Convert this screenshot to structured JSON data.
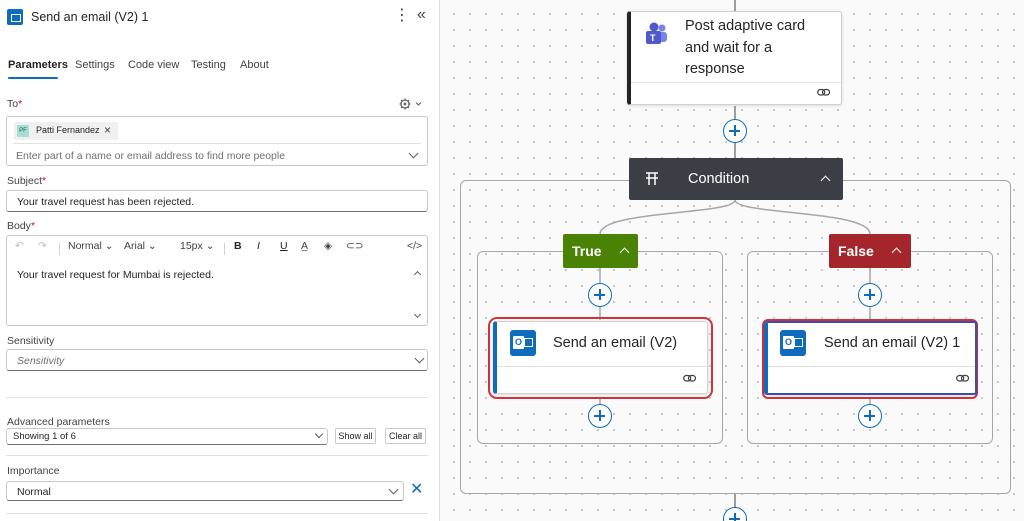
{
  "panel": {
    "title": "Send an email (V2) 1",
    "more_glyph": "⋮",
    "collapse_glyph": "«",
    "tabs": [
      {
        "label": "Parameters",
        "active": true
      },
      {
        "label": "Settings",
        "active": false
      },
      {
        "label": "Code view",
        "active": false
      },
      {
        "label": "Testing",
        "active": false
      },
      {
        "label": "About",
        "active": false
      }
    ],
    "to": {
      "label": "To",
      "recipient_initials": "PF",
      "recipient_name": "Patti Fernandez",
      "placeholder": "Enter part of a name or email address to find more people"
    },
    "subject": {
      "label": "Subject",
      "value": "Your travel request has been rejected."
    },
    "body": {
      "label": "Body",
      "value": "Your travel request for Mumbai is rejected.",
      "toolbar": {
        "font": "Normal",
        "family": "Arial",
        "size": "15px",
        "bold": "B",
        "italic": "I",
        "underline": "U",
        "code": "</>"
      }
    },
    "sensitivity": {
      "label": "Sensitivity",
      "placeholder": "Sensitivity"
    },
    "advanced": {
      "label": "Advanced parameters",
      "value": "Showing 1 of 6",
      "show_all": "Show all",
      "clear_all": "Clear all"
    },
    "importance": {
      "label": "Importance",
      "value": "Normal"
    },
    "required_mark": "*"
  },
  "canvas": {
    "post_card": {
      "title_line1": "Post adaptive card",
      "title_line2": "and wait for a",
      "title_line3": "response"
    },
    "condition": {
      "label": "Condition"
    },
    "true_branch": {
      "label": "True",
      "color": "#498205",
      "action": "Send an email (V2)"
    },
    "false_branch": {
      "label": "False",
      "color": "#a4262c",
      "action": "Send an email (V2) 1"
    },
    "header_color": "#3b3f45",
    "highlight_color": "#d13438"
  }
}
